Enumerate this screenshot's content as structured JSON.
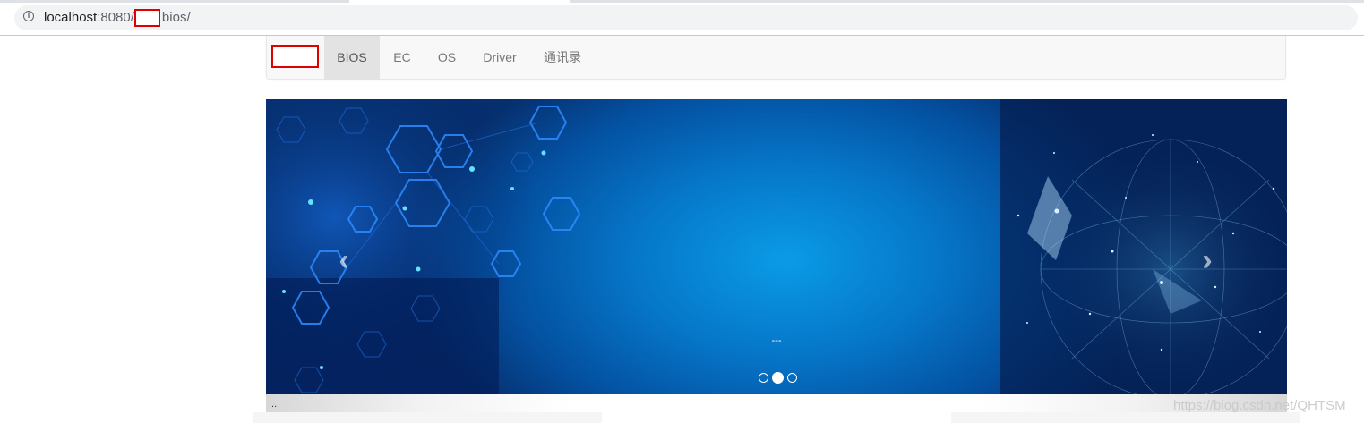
{
  "browser": {
    "url_host": "localhost",
    "url_port": ":8080/",
    "url_path": "bios/"
  },
  "navbar": {
    "items": [
      {
        "label": "BIOS",
        "active": true
      },
      {
        "label": "EC",
        "active": false
      },
      {
        "label": "OS",
        "active": false
      },
      {
        "label": "Driver",
        "active": false
      },
      {
        "label": "通讯录",
        "active": false
      }
    ]
  },
  "carousel": {
    "caption": "---",
    "prev_icon": "chevron-left-icon",
    "next_icon": "chevron-right-icon",
    "slide_count": 3,
    "active_slide": 2
  },
  "footer": {
    "text": "..."
  },
  "watermark": "https://blog.csdn.net/QHTSM"
}
